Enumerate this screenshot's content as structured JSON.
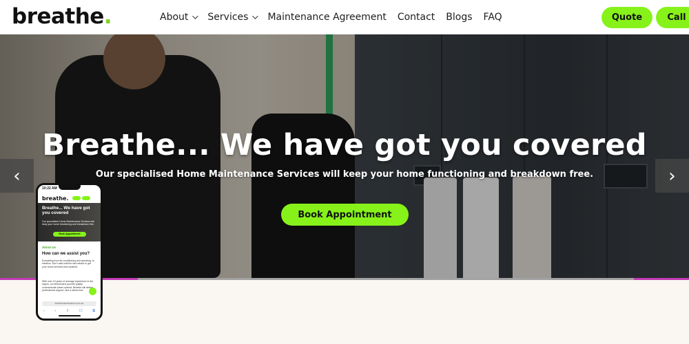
{
  "header": {
    "logo_text": "breathe",
    "logo_dot": ".",
    "nav": [
      {
        "label": "About",
        "has_dropdown": true
      },
      {
        "label": "Services",
        "has_dropdown": true
      },
      {
        "label": "Maintenance Agreement",
        "has_dropdown": false
      },
      {
        "label": "Contact",
        "has_dropdown": false
      },
      {
        "label": "Blogs",
        "has_dropdown": false
      },
      {
        "label": "FAQ",
        "has_dropdown": false
      }
    ],
    "quote_label": "Quote",
    "call_label": "Call"
  },
  "hero": {
    "title": "Breathe... We have got you covered",
    "subtitle": "Our specialised Home Maintenance Services will keep your home functioning and breakdown free.",
    "cta_label": "Book Appointment",
    "prev_icon": "chevron-left-icon",
    "next_icon": "chevron-right-icon",
    "prev_glyph": "‹",
    "next_glyph": "›"
  },
  "phone": {
    "status_time": "10:22 AM",
    "logo_text": "breathe.",
    "hero_title": "Breathe... We have got you covered",
    "hero_sub": "Our specialised Home Maintenance Services will keep your home functioning and breakdown free.",
    "hero_cta": "Book Appointment",
    "about_label": "About Us",
    "heading": "How can we assist you?",
    "text1": "Everything from air conditioning and plumbing, to electrics. Don't wait until the last minute to get your home serviced and repaired.",
    "text2": "With over 10 years of average experience in the region, our technicians provide quality, communicate prices upfront, Breathe will deliver professional support, and a stress free.",
    "url": "breathemaintenance.com.au",
    "toolbar_icons": [
      "‹",
      "›",
      "⇪",
      "☐",
      "⧉"
    ]
  },
  "colors": {
    "accent": "#87f21a",
    "logo_dot": "#7ed321",
    "divider_accent": "#c43bb5",
    "lower_bg": "#faf6f2"
  }
}
